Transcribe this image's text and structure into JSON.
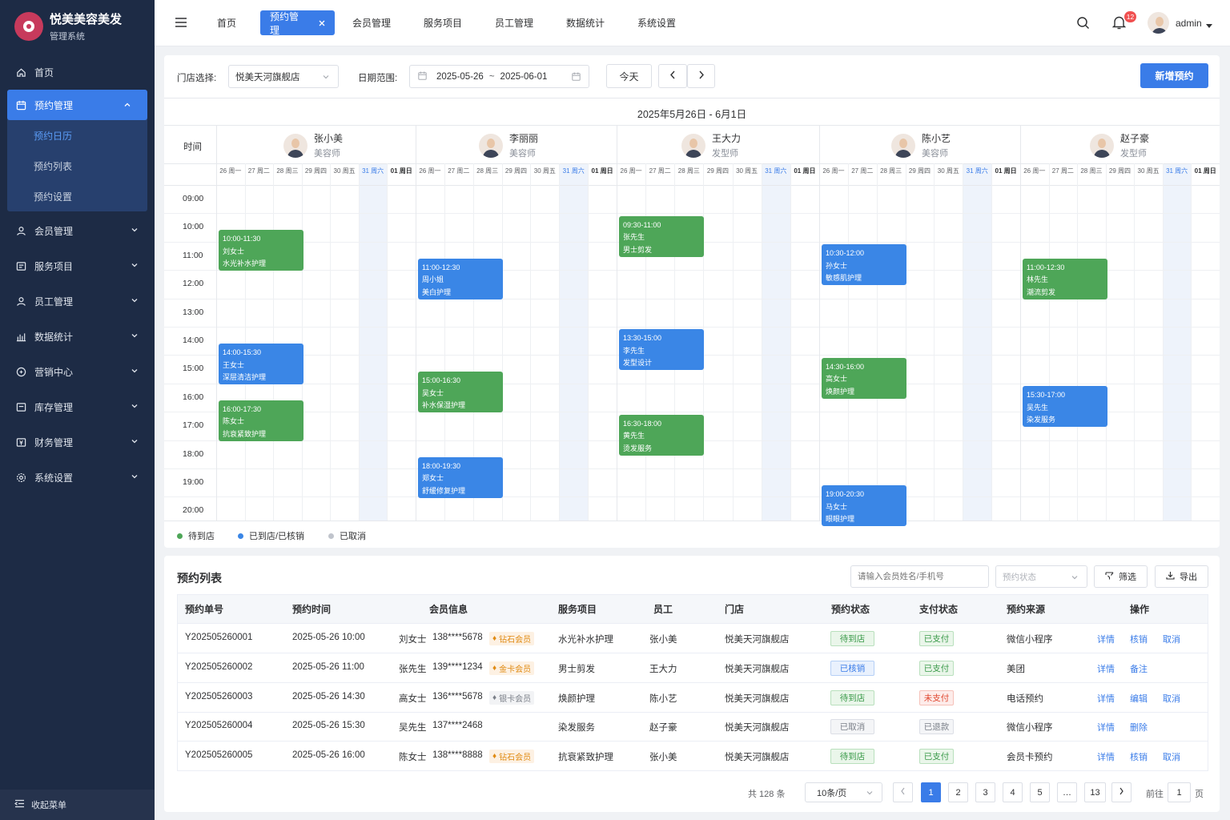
{
  "app": {
    "name": "悦美美容美发",
    "subtitle": "管理系统"
  },
  "sidebar": {
    "items": [
      {
        "label": "首页",
        "icon": "home-icon"
      },
      {
        "label": "预约管理",
        "icon": "calendar-icon"
      },
      {
        "label": "会员管理",
        "icon": "user-icon"
      },
      {
        "label": "服务项目",
        "icon": "list-icon"
      },
      {
        "label": "员工管理",
        "icon": "staff-icon"
      },
      {
        "label": "数据统计",
        "icon": "bar-chart-icon"
      },
      {
        "label": "营销中心",
        "icon": "marketing-icon"
      },
      {
        "label": "库存管理",
        "icon": "inventory-icon"
      },
      {
        "label": "财务管理",
        "icon": "finance-icon"
      },
      {
        "label": "系统设置",
        "icon": "settings-icon"
      }
    ],
    "submenu": [
      "预约日历",
      "预约列表",
      "预约设置"
    ],
    "collapse_label": "收起菜单"
  },
  "topnav": {
    "tabs": [
      "首页",
      "预约管理",
      "会员管理",
      "服务项目",
      "员工管理",
      "数据统计",
      "系统设置"
    ],
    "notification_count": "12",
    "user": "admin"
  },
  "filters": {
    "store_label": "门店选择:",
    "store_value": "悦美天河旗舰店",
    "date_label": "日期范围:",
    "date_start": "2025-05-26",
    "date_sep": "~",
    "date_end": "2025-06-01",
    "today_button": "今天",
    "new_button": "新增预约"
  },
  "calendar": {
    "range_title": "2025年5月26日 - 6月1日",
    "time_header": "时间",
    "hours": [
      "09:00",
      "10:00",
      "11:00",
      "12:00",
      "13:00",
      "14:00",
      "15:00",
      "16:00",
      "17:00",
      "18:00",
      "19:00",
      "20:00"
    ],
    "days": [
      "26 周一",
      "27 周二",
      "28 周三",
      "29 周四",
      "30 周五",
      "31 周六",
      "01 周日"
    ],
    "staff": [
      {
        "name": "张小美",
        "role": "美容师"
      },
      {
        "name": "李丽丽",
        "role": "美容师"
      },
      {
        "name": "王大力",
        "role": "发型师"
      },
      {
        "name": "陈小艺",
        "role": "美容师"
      },
      {
        "name": "赵子豪",
        "role": "发型师"
      }
    ],
    "appointments": [
      {
        "time": "10:00-11:30",
        "customer": "刘女士",
        "service": "水光补水护理",
        "status": "待到店"
      },
      {
        "time": "14:00-15:30",
        "customer": "王女士",
        "service": "深层清洁护理",
        "status": "已到店"
      },
      {
        "time": "16:00-17:30",
        "customer": "陈女士",
        "service": "抗衰紧致护理",
        "status": "待到店"
      },
      {
        "time": "11:00-12:30",
        "customer": "周小姐",
        "service": "美白护理",
        "status": "已到店"
      },
      {
        "time": "15:00-16:30",
        "customer": "吴女士",
        "service": "补水保湿护理",
        "status": "待到店"
      },
      {
        "time": "18:00-19:30",
        "customer": "郑女士",
        "service": "舒缓修复护理",
        "status": "已到店"
      },
      {
        "time": "09:30-11:00",
        "customer": "张先生",
        "service": "男士剪发",
        "status": "待到店"
      },
      {
        "time": "13:30-15:00",
        "customer": "李先生",
        "service": "发型设计",
        "status": "已到店"
      },
      {
        "time": "16:30-18:00",
        "customer": "黄先生",
        "service": "烫发服务",
        "status": "待到店"
      },
      {
        "time": "10:30-12:00",
        "customer": "孙女士",
        "service": "敏感肌护理",
        "status": "已到店"
      },
      {
        "time": "14:30-16:00",
        "customer": "高女士",
        "service": "焕颜护理",
        "status": "待到店"
      },
      {
        "time": "19:00-20:30",
        "customer": "马女士",
        "service": "眼眼护理",
        "status": "已到店"
      },
      {
        "time": "11:00-12:30",
        "customer": "林先生",
        "service": "潮流剪发",
        "status": "待到店"
      },
      {
        "time": "15:30-17:00",
        "customer": "吴先生",
        "service": "染发服务",
        "status": "已到店"
      }
    ],
    "legend": [
      {
        "label": "待到店",
        "color": "#4ea658"
      },
      {
        "label": "已到店/已核销",
        "color": "#3a86e6"
      },
      {
        "label": "已取消",
        "color": "#c0c4cc"
      }
    ]
  },
  "list": {
    "title": "预约列表",
    "search_placeholder": "请输入会员姓名/手机号",
    "status_placeholder": "预约状态",
    "filter_button": "筛选",
    "export_button": "导出",
    "columns": [
      "预约单号",
      "预约时间",
      "会员信息",
      "服务项目",
      "员工",
      "门店",
      "预约状态",
      "支付状态",
      "预约来源",
      "操作"
    ],
    "rows": [
      {
        "id": "Y202505260001",
        "time": "2025-05-26 10:00",
        "member": "刘女士",
        "phone": "138****5678",
        "level": "钻石会员",
        "service": "水光补水护理",
        "staff": "张小美",
        "store": "悦美天河旗舰店",
        "status": "待到店",
        "pay": "已支付",
        "source": "微信小程序",
        "ops": [
          "详情",
          "核销",
          "取消"
        ]
      },
      {
        "id": "Y202505260002",
        "time": "2025-05-26 11:00",
        "member": "张先生",
        "phone": "139****1234",
        "level": "金卡会员",
        "service": "男士剪发",
        "staff": "王大力",
        "store": "悦美天河旗舰店",
        "status": "已核销",
        "pay": "已支付",
        "source": "美团",
        "ops": [
          "详情",
          "备注"
        ]
      },
      {
        "id": "Y202505260003",
        "time": "2025-05-26 14:30",
        "member": "高女士",
        "phone": "136****5678",
        "level": "银卡会员",
        "service": "焕颜护理",
        "staff": "陈小艺",
        "store": "悦美天河旗舰店",
        "status": "待到店",
        "pay": "未支付",
        "source": "电话预约",
        "ops": [
          "详情",
          "编辑",
          "取消"
        ]
      },
      {
        "id": "Y202505260004",
        "time": "2025-05-26 15:30",
        "member": "吴先生",
        "phone": "137****2468",
        "level": "",
        "service": "染发服务",
        "staff": "赵子豪",
        "store": "悦美天河旗舰店",
        "status": "已取消",
        "pay": "已退款",
        "source": "微信小程序",
        "ops": [
          "详情",
          "删除"
        ]
      },
      {
        "id": "Y202505260005",
        "time": "2025-05-26 16:00",
        "member": "陈女士",
        "phone": "138****8888",
        "level": "钻石会员",
        "service": "抗衰紧致护理",
        "staff": "张小美",
        "store": "悦美天河旗舰店",
        "status": "待到店",
        "pay": "已支付",
        "source": "会员卡预约",
        "ops": [
          "详情",
          "核销",
          "取消"
        ]
      }
    ]
  },
  "pagination": {
    "total": "共 128 条",
    "page_size": "10条/页",
    "pages": [
      "1",
      "2",
      "3",
      "4",
      "5",
      "…",
      "13"
    ],
    "goto_label": "前往",
    "goto_value": "1",
    "page_unit": "页"
  }
}
